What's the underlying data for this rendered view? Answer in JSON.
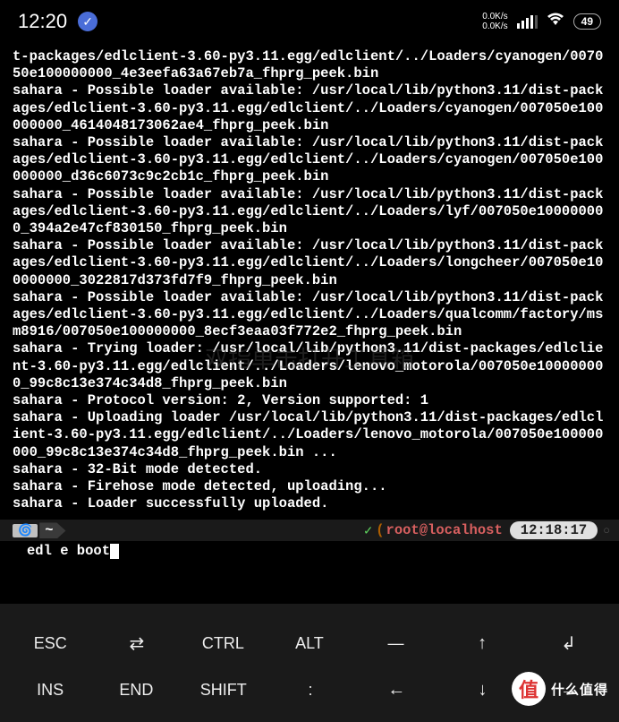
{
  "status": {
    "time": "12:20",
    "speed_down": "0.0K/s",
    "speed_up": "0.0K/s",
    "battery": "49"
  },
  "terminal": {
    "output": "t-packages/edlclient-3.60-py3.11.egg/edlclient/../Loaders/cyanogen/007050e100000000_4e3eefa63a67eb7a_fhprg_peek.bin\nsahara - Possible loader available: /usr/local/lib/python3.11/dist-packages/edlclient-3.60-py3.11.egg/edlclient/../Loaders/cyanogen/007050e100000000_4614048173062ae4_fhprg_peek.bin\nsahara - Possible loader available: /usr/local/lib/python3.11/dist-packages/edlclient-3.60-py3.11.egg/edlclient/../Loaders/cyanogen/007050e100000000_d36c6073c9c2cb1c_fhprg_peek.bin\nsahara - Possible loader available: /usr/local/lib/python3.11/dist-packages/edlclient-3.60-py3.11.egg/edlclient/../Loaders/lyf/007050e100000000_394a2e47cf830150_fhprg_peek.bin\nsahara - Possible loader available: /usr/local/lib/python3.11/dist-packages/edlclient-3.60-py3.11.egg/edlclient/../Loaders/longcheer/007050e100000000_3022817d373fd7f9_fhprg_peek.bin\nsahara - Possible loader available: /usr/local/lib/python3.11/dist-packages/edlclient-3.60-py3.11.egg/edlclient/../Loaders/qualcomm/factory/msm8916/007050e100000000_8ecf3eaa03f772e2_fhprg_peek.bin\nsahara - Trying loader: /usr/local/lib/python3.11/dist-packages/edlclient-3.60-py3.11.egg/edlclient/../Loaders/lenovo_motorola/007050e100000000_99c8c13e374c34d8_fhprg_peek.bin\nsahara - Protocol version: 2, Version supported: 1\nsahara - Uploading loader /usr/local/lib/python3.11/dist-packages/edlclient-3.60-py3.11.egg/edlclient/../Loaders/lenovo_motorola/007050e100000000_99c8c13e374c34d8_fhprg_peek.bin ...\nsahara - 32-Bit mode detected.\nsahara - Firehose mode detected, uploading...\nsahara - Loader successfully uploaded.",
    "prompt": {
      "os_icon": "🌀",
      "path": "~",
      "check": "✓",
      "paren_open": "(",
      "user": "root@localhost",
      "time_badge": "12:18:17",
      "clock": "○"
    },
    "input": "edl e boot"
  },
  "keyboard": {
    "row1": [
      "ESC",
      "⇄",
      "CTRL",
      "ALT",
      "—",
      "↑",
      "↲"
    ],
    "row2": [
      "INS",
      "END",
      "SHIFT",
      ":",
      "←",
      "↓",
      "→"
    ]
  },
  "watermark": {
    "icon": "值",
    "text": "什么值得"
  }
}
